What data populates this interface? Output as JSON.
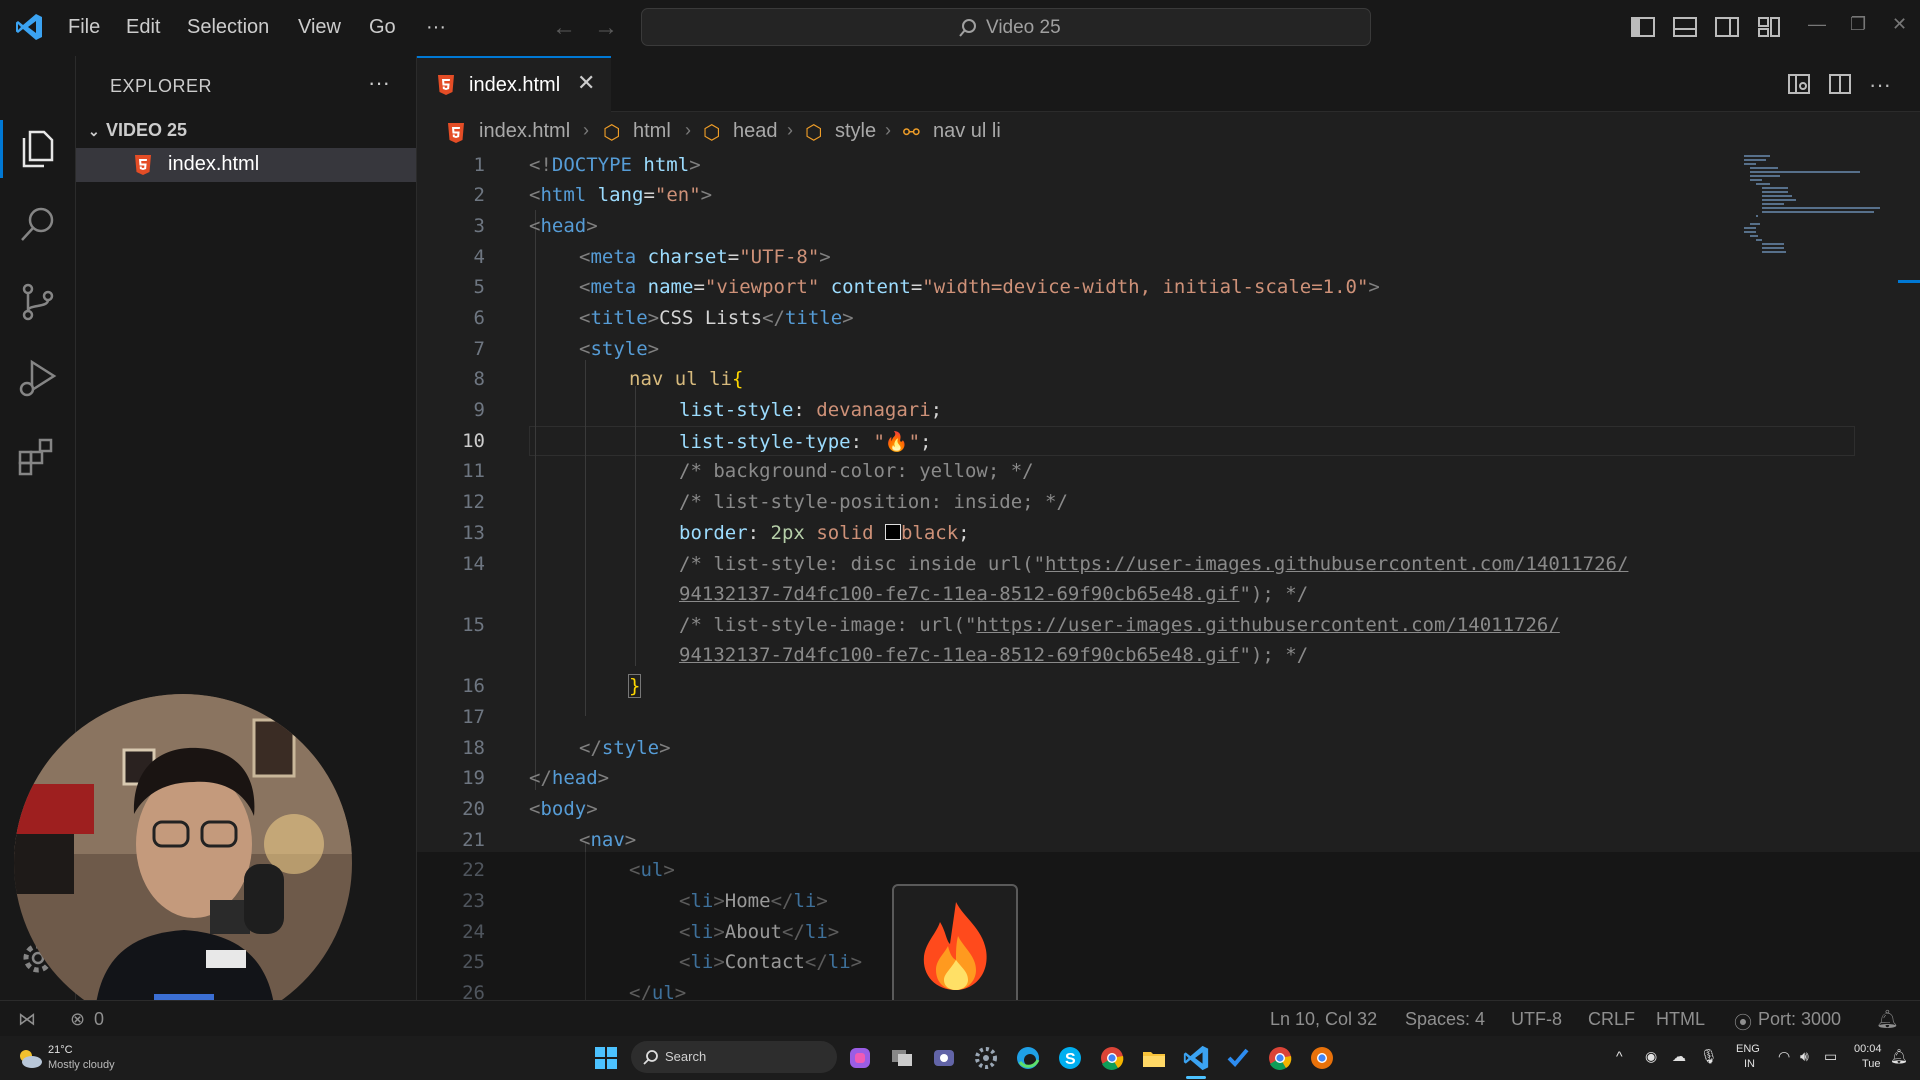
{
  "menu": [
    "File",
    "Edit",
    "Selection",
    "View",
    "Go",
    "···"
  ],
  "command_center": "Video 25",
  "sidebar": {
    "title": "EXPLORER",
    "folder": "VIDEO 25",
    "files": [
      "index.html"
    ]
  },
  "tab": {
    "label": "index.html"
  },
  "breadcrumb": [
    "index.html",
    "html",
    "head",
    "style",
    "nav ul li"
  ],
  "line_numbers": [
    "1",
    "2",
    "3",
    "4",
    "5",
    "6",
    "7",
    "8",
    "9",
    "10",
    "11",
    "12",
    "13",
    "14",
    "",
    "15",
    "",
    "16",
    "17",
    "18",
    "19",
    "20",
    "21",
    "22",
    "23",
    "24",
    "25",
    "26"
  ],
  "code": {
    "l1": "DOCTYPE",
    "l1b": "html",
    "l2": "html",
    "l2a": "lang",
    "l2v": "\"en\"",
    "l3": "head",
    "l4": "meta",
    "l4a": "charset",
    "l4v": "\"UTF-8\"",
    "l5": "meta",
    "l5a": "name",
    "l5v": "\"viewport\"",
    "l5a2": "content",
    "l5v2": "\"width=device-width, initial-scale=1.0\"",
    "l6a": "title",
    "l6t": "CSS Lists",
    "l6b": "title",
    "l7": "style",
    "l8sel": "nav ul li",
    "l9p": "list-style",
    "l9v": "devanagari",
    "l10p": "list-style-type",
    "l10v": "\"🔥\"",
    "l11": "/* background-color: yellow; */",
    "l12": "/* list-style-position: inside; */",
    "l13p": "border",
    "l13n": "2px",
    "l13v": "solid",
    "l13c": "black",
    "l14a": "/* list-style: disc inside url(\"",
    "l14u": "https://user-images.githubusercontent.com/14011726/",
    "l14u2": "94132137-7d4fc100-fe7c-11ea-8512-69f90cb65e48.gif",
    "l14b": "\"); */",
    "l15a": "/* list-style-image: url(\"",
    "l15u": "https://user-images.githubusercontent.com/14011726/",
    "l15u2": "94132137-7d4fc100-fe7c-11ea-8512-69f90cb65e48.gif",
    "l15b": "\"); */",
    "l18": "style",
    "l19": "head",
    "l20": "body",
    "l21": "nav",
    "l22": "ul",
    "l23": "Home",
    "l24": "About",
    "l25": "Contact",
    "l26": "ul",
    "li": "li"
  },
  "status": {
    "errors": "0",
    "position": "Ln 10, Col 32",
    "spaces": "Spaces: 4",
    "encoding": "UTF-8",
    "eol": "CRLF",
    "language": "HTML",
    "port": "Port: 3000"
  },
  "taskbar": {
    "temp": "21°C",
    "weather": "Mostly cloudy",
    "search": "Search",
    "lang1": "ENG",
    "lang2": "IN",
    "time": "00:04",
    "day": "Tue"
  },
  "colors": {
    "accent": "#0078d4",
    "editor_bg": "#1f1f1f",
    "chrome_bg": "#181818"
  }
}
